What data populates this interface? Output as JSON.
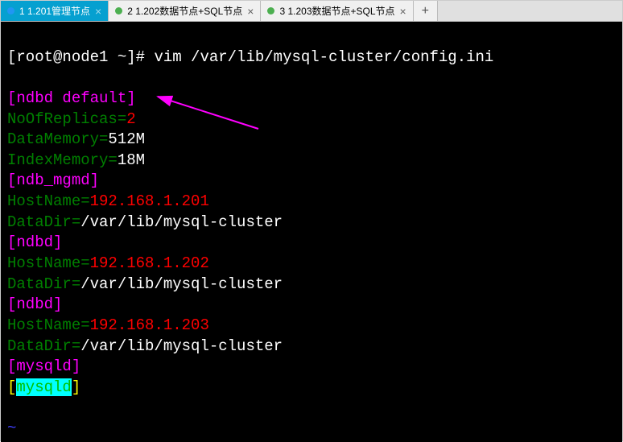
{
  "tabs": [
    {
      "label": "1 1.201管理节点",
      "active": true,
      "dot": "blue"
    },
    {
      "label": "2 1.202数据节点+SQL节点",
      "active": false,
      "dot": "green"
    },
    {
      "label": "3 1.203数据节点+SQL节点",
      "active": false,
      "dot": "green"
    }
  ],
  "prompt": "[root@node1 ~]# ",
  "command": "vim /var/lib/mysql-cluster/config.ini",
  "config": {
    "ndbd_default_header": "[ndbd default]",
    "noofreplicas_key": "NoOfReplicas=",
    "noofreplicas_val": "2",
    "datamemory_key": "DataMemory=",
    "datamemory_val": "512M",
    "indexmemory_key": "IndexMemory=",
    "indexmemory_val": "18M",
    "ndb_mgmd_header": "[ndb_mgmd]",
    "hostname_key": "HostName=",
    "host1": "192.168.1.201",
    "host2": "192.168.1.202",
    "host3": "192.168.1.203",
    "datadir_key": "DataDir=",
    "datadir_val": "/var/lib/mysql-cluster",
    "ndbd_header": "[ndbd]",
    "mysqld_header": "[mysqld]",
    "cursor_open": "[",
    "cursor_text": "mysqld",
    "cursor_close": "]",
    "tilde": "~"
  }
}
